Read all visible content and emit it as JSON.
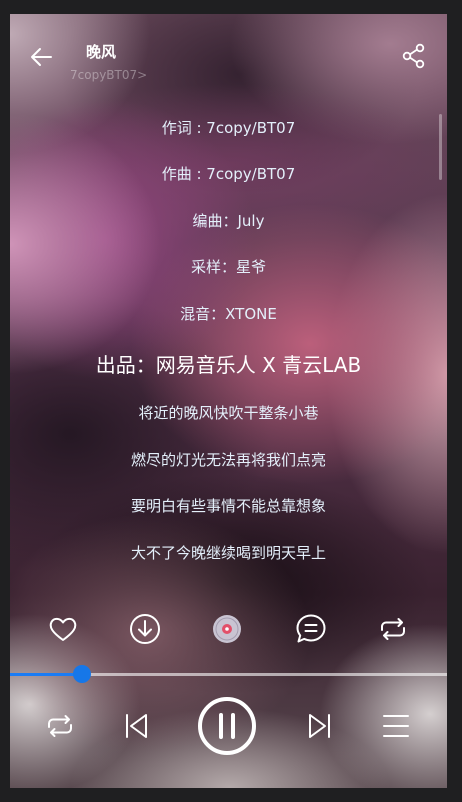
{
  "header": {
    "title": "晚风",
    "artist": "7copyBT07",
    "artist_chevron": ">"
  },
  "lyrics": [
    {
      "text": "作词 : 7copy/BT07",
      "highlight": false
    },
    {
      "text": "作曲 : 7copy/BT07",
      "highlight": false
    },
    {
      "text": "编曲：July",
      "highlight": false
    },
    {
      "text": "采样：星爷",
      "highlight": false
    },
    {
      "text": "混音：XTONE",
      "highlight": false
    },
    {
      "text": "出品：网易音乐人 X 青云LAB",
      "highlight": true
    },
    {
      "text": "将近的晚风快吹干整条小巷",
      "highlight": false
    },
    {
      "text": "燃尽的灯光无法再将我们点亮",
      "highlight": false
    },
    {
      "text": "要明白有些事情不能总靠想象",
      "highlight": false
    },
    {
      "text": "大不了今晚继续喝到明天早上",
      "highlight": false
    }
  ],
  "actions": [
    "heart-icon",
    "download-icon",
    "sound-effect-icon",
    "comment-icon",
    "repeat-icon"
  ],
  "playback": {
    "progress": 0.165,
    "is_playing": true
  },
  "controls": [
    "loop-mode-icon",
    "previous-icon",
    "pause-icon",
    "next-icon",
    "playlist-icon"
  ],
  "colors": {
    "accent": "#1677e8",
    "text": "#ffffff",
    "lyric_blue": "#e4f0fb"
  }
}
